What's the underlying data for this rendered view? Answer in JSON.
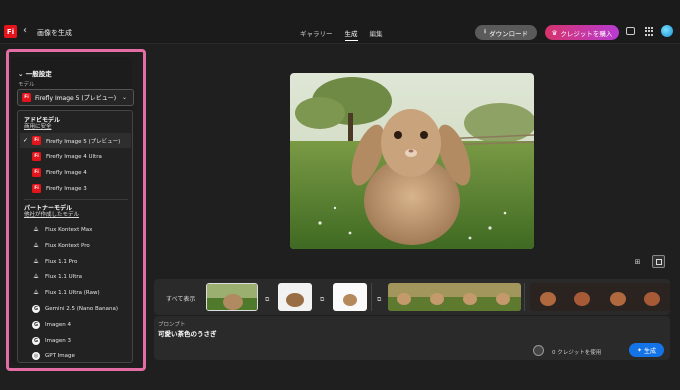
{
  "header": {
    "logo_text": "Fi",
    "back_icon": "chevron-left-icon",
    "page_title": "画像を生成",
    "tabs": [
      {
        "label": "ギャラリー"
      },
      {
        "label": "生成"
      },
      {
        "label": "編集"
      }
    ],
    "download_label": "ダウンロード",
    "buy_credits_label": "クレジットを購入"
  },
  "settings": {
    "section_title": "一般設定",
    "model_label": "モデル",
    "selected_model": "Firefly Image 5 (プレビュー)"
  },
  "dropdown": {
    "adobe_group_title": "アドビモデル",
    "adobe_group_subtitle": "商用に安全",
    "adobe_models": [
      {
        "label": "Firefly Image 5 (プレビュー)"
      },
      {
        "label": "Firefly Image 4 Ultra"
      },
      {
        "label": "Firefly Image 4"
      },
      {
        "label": "Firefly Image 3"
      }
    ],
    "partner_group_title": "パートナーモデル",
    "partner_group_subtitle": "他社が作成したモデル",
    "partner_models": [
      {
        "label": "Flux Kontext Max"
      },
      {
        "label": "Flux Kontext Pro"
      },
      {
        "label": "Flux 1.1 Pro"
      },
      {
        "label": "Flux 1.1 Ultra"
      },
      {
        "label": "Flux 1.1 Ultra (Raw)"
      },
      {
        "label": "Gemini 2.5 (Nano Banana)"
      },
      {
        "label": "Imagen 4"
      },
      {
        "label": "Imagen 3"
      },
      {
        "label": "GPT Image"
      }
    ]
  },
  "strip": {
    "show_all_label": "すべて表示"
  },
  "prompt": {
    "label": "プロンプト",
    "text": "可愛い茶色のうさぎ",
    "credits_text": "0 クレジットを使用",
    "generate_label": "生成"
  },
  "colors": {
    "accent_blue": "#1473e6",
    "brand_red": "#e4141c",
    "highlight_pink": "#e46da6"
  }
}
